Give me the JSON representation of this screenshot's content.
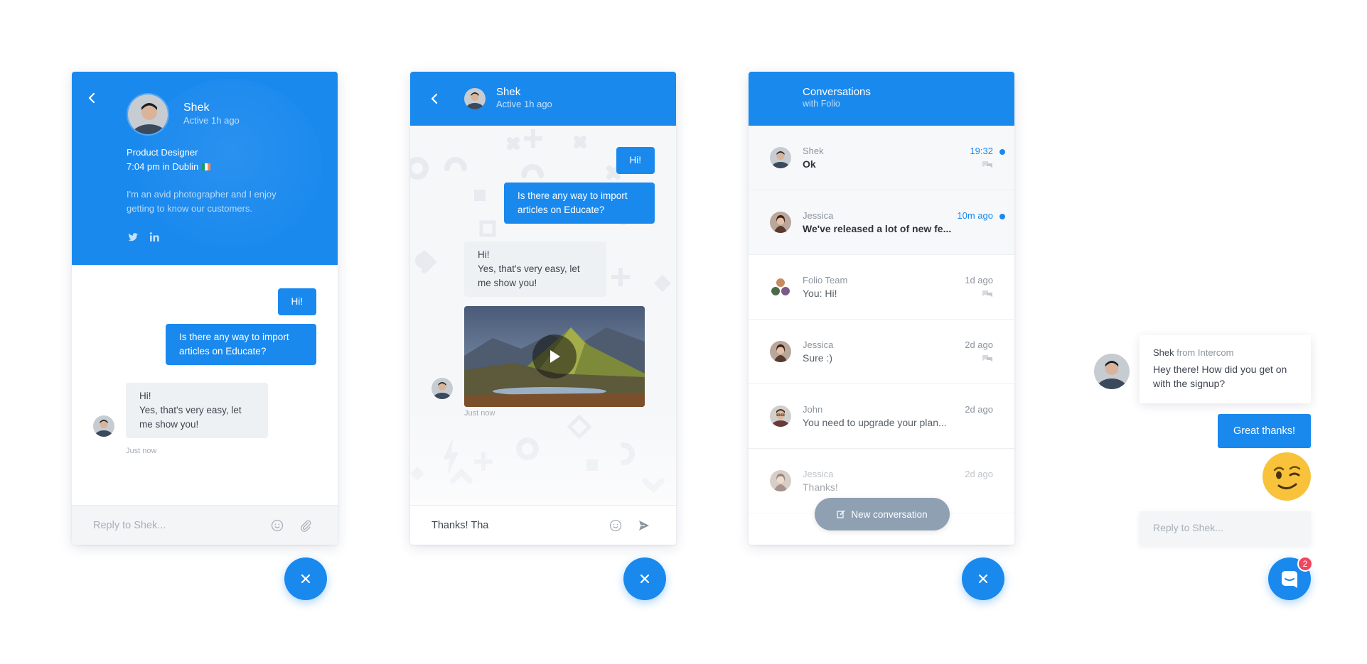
{
  "colors": {
    "brand": "#1a89ee",
    "badge": "#f0465f",
    "muted": "#8c949d"
  },
  "profile_panel": {
    "name": "Shek",
    "active": "Active 1h ago",
    "role": "Product Designer",
    "location": "7:04 pm in Dublin",
    "bio": "I'm an avid photographer and I enjoy getting to know our customers.",
    "social": [
      "twitter-icon",
      "linkedin-icon"
    ],
    "messages": [
      {
        "dir": "out",
        "text": "Hi!"
      },
      {
        "dir": "out",
        "text": "Is there any way to import articles on Educate?"
      },
      {
        "dir": "in",
        "text": "Hi!\nYes, that's very easy, let me show you!"
      }
    ],
    "timestamp": "Just now",
    "composer_placeholder": "Reply to Shek..."
  },
  "chat_panel": {
    "name": "Shek",
    "active": "Active 1h ago",
    "messages": [
      {
        "dir": "out",
        "text": "Hi!"
      },
      {
        "dir": "out",
        "text": "Is there any way to import articles on Educate?"
      },
      {
        "dir": "in",
        "text": "Hi!\nYes, that's very easy, let me show you!"
      }
    ],
    "timestamp": "Just now",
    "composer_value": "Thanks! Tha"
  },
  "conversations_panel": {
    "title": "Conversations",
    "subtitle": "with Folio",
    "items": [
      {
        "name": "Shek",
        "message": "Ok",
        "time": "19:32",
        "unread": true
      },
      {
        "name": "Jessica",
        "message": "We've released a lot of new fe...",
        "time": "10m ago",
        "unread": true
      },
      {
        "name": "Folio Team",
        "message": "You: Hi!",
        "time": "1d ago",
        "unread": false
      },
      {
        "name": "Jessica",
        "message": "Sure :)",
        "time": "2d ago",
        "unread": false
      },
      {
        "name": "John",
        "message": "You need to upgrade your plan...",
        "time": "2d ago",
        "unread": false
      },
      {
        "name": "Jessica",
        "message": "Thanks!",
        "time": "2d ago",
        "unread": false
      }
    ],
    "new_conversation": "New conversation"
  },
  "launcher": {
    "sender": "Shek",
    "sender_from": "from Intercom",
    "message": "Hey there! How did you get on with the signup?",
    "reply": "Great  thanks!",
    "emoji": "winking-face",
    "reply_placeholder": "Reply to Shek...",
    "badge_count": "2"
  }
}
